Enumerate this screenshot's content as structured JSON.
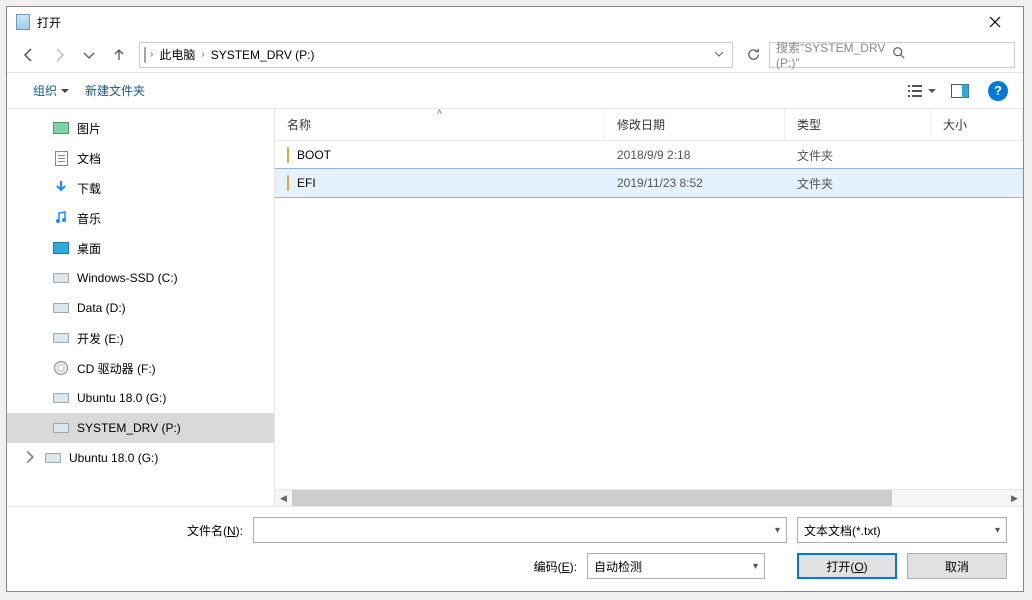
{
  "window": {
    "title": "打开"
  },
  "address": {
    "root": "此电脑",
    "current": "SYSTEM_DRV (P:)"
  },
  "search": {
    "placeholder": "搜索\"SYSTEM_DRV (P:)\""
  },
  "toolbar": {
    "organize": "组织",
    "new_folder": "新建文件夹"
  },
  "columns": {
    "name": "名称",
    "date": "修改日期",
    "type": "类型",
    "size": "大小"
  },
  "tree": [
    {
      "label": "图片",
      "icon": "picture",
      "indent": 1
    },
    {
      "label": "文档",
      "icon": "document",
      "indent": 1
    },
    {
      "label": "下载",
      "icon": "download",
      "indent": 1
    },
    {
      "label": "音乐",
      "icon": "music",
      "indent": 1
    },
    {
      "label": "桌面",
      "icon": "monitor",
      "indent": 1
    },
    {
      "label": "Windows-SSD (C:)",
      "icon": "drive-sys",
      "indent": 1
    },
    {
      "label": "Data (D:)",
      "icon": "drive",
      "indent": 1
    },
    {
      "label": "开发 (E:)",
      "icon": "drive",
      "indent": 1
    },
    {
      "label": "CD 驱动器 (F:)",
      "icon": "disc",
      "indent": 1
    },
    {
      "label": "Ubuntu 18.0 (G:)",
      "icon": "drive",
      "indent": 1
    },
    {
      "label": "SYSTEM_DRV (P:)",
      "icon": "drive",
      "indent": 1,
      "selected": true
    },
    {
      "label": "Ubuntu 18.0 (G:)",
      "icon": "drive",
      "indent": 0,
      "expandable": true
    }
  ],
  "files": [
    {
      "name": "BOOT",
      "date": "2018/9/9 2:18",
      "type": "文件夹",
      "icon": "folder"
    },
    {
      "name": "EFI",
      "date": "2019/11/23 8:52",
      "type": "文件夹",
      "icon": "folder",
      "selected": true
    }
  ],
  "bottom": {
    "filename_label_pre": "文件名(",
    "filename_label_key": "N",
    "filename_label_post": "):",
    "filename_value": "",
    "filter": "文本文档(*.txt)",
    "encoding_label_pre": "编码(",
    "encoding_label_key": "E",
    "encoding_label_post": "):",
    "encoding_value": "自动检测",
    "open_pre": "打开(",
    "open_key": "O",
    "open_post": ")",
    "cancel": "取消"
  }
}
